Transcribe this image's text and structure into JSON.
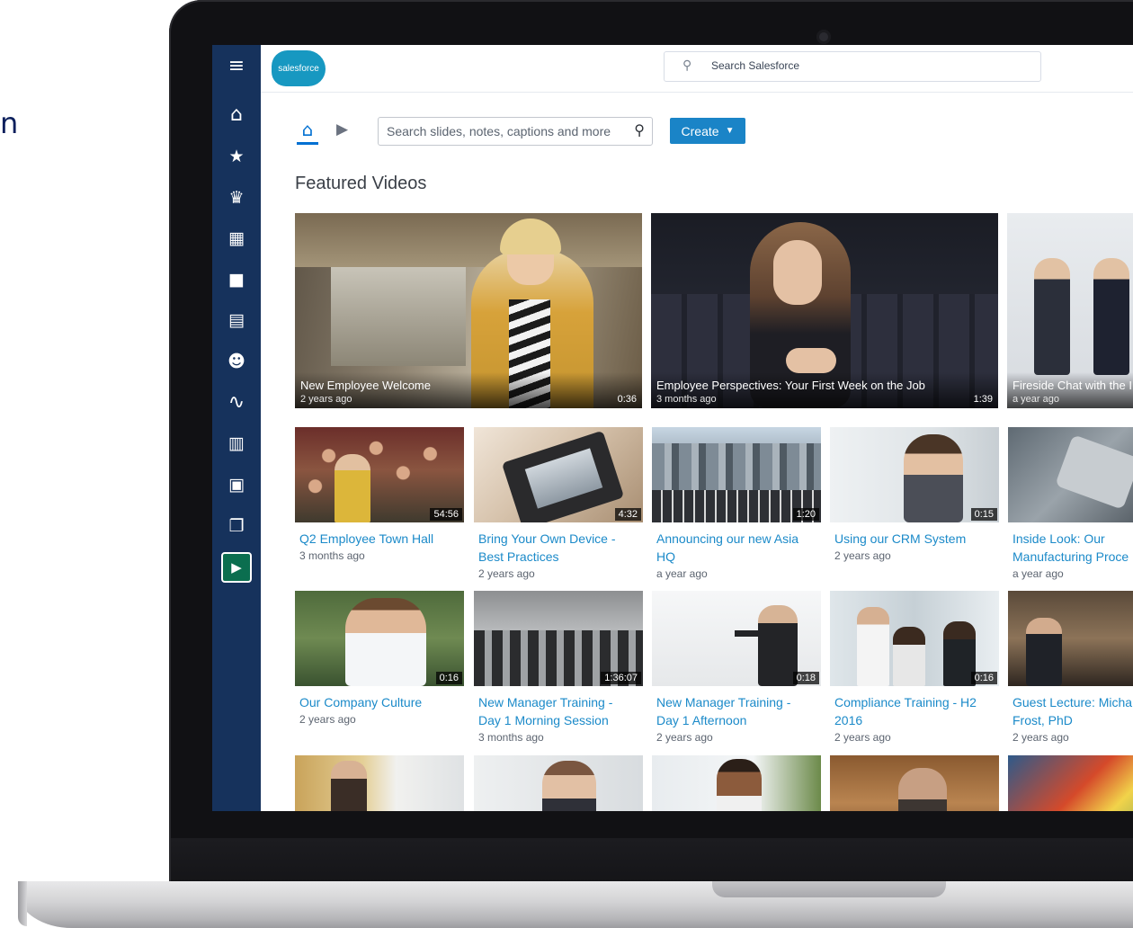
{
  "slide_fragment_text": "n",
  "header": {
    "logo_label": "salesforce",
    "global_search_placeholder": "Search Salesforce"
  },
  "sidebar": {
    "items": [
      {
        "icon": "hamburger-menu-icon",
        "glyph": "≡"
      },
      {
        "icon": "home-icon",
        "glyph": "⌂"
      },
      {
        "icon": "person-star-icon",
        "glyph": "★"
      },
      {
        "icon": "crown-icon",
        "glyph": "♛"
      },
      {
        "icon": "building-icon",
        "glyph": "▦"
      },
      {
        "icon": "briefcase-icon",
        "glyph": "■"
      },
      {
        "icon": "contact-card-icon",
        "glyph": "▤"
      },
      {
        "icon": "groups-icon",
        "glyph": "☻"
      },
      {
        "icon": "activity-pulse-icon",
        "glyph": "∿"
      },
      {
        "icon": "news-feed-icon",
        "glyph": "▥"
      },
      {
        "icon": "report-clipboard-icon",
        "glyph": "▣"
      },
      {
        "icon": "documents-icon",
        "glyph": "❐"
      },
      {
        "icon": "video-app-icon",
        "glyph": "▶",
        "active": true
      }
    ]
  },
  "toolbar": {
    "search_placeholder": "Search slides, notes, captions and more",
    "create_label": "Create",
    "create_caret": "▼"
  },
  "section_title": "Featured Videos",
  "featured": [
    {
      "title": "New Employee Welcome",
      "age": "2 years ago",
      "duration": "0:36"
    },
    {
      "title": "Employee Perspectives: Your First Week on the Job",
      "age": "3 months ago",
      "duration": "1:39"
    },
    {
      "title": "Fireside Chat with the I",
      "age": "a year ago",
      "duration": ""
    }
  ],
  "videos": [
    {
      "title": "Q2 Employee Town Hall",
      "age": "3 months ago",
      "duration": "54:56"
    },
    {
      "title": "Bring Your Own Device - Best Practices",
      "age": "2 years ago",
      "duration": "4:32"
    },
    {
      "title": "Announcing our new Asia HQ",
      "age": "a year ago",
      "duration": "1:20"
    },
    {
      "title": "Using our CRM System",
      "age": "2 years ago",
      "duration": "0:15"
    },
    {
      "title": "Inside Look: Our Manufacturing Proce",
      "age": "a year ago",
      "duration": ""
    },
    {
      "title": "Our Company Culture",
      "age": "2 years ago",
      "duration": "0:16"
    },
    {
      "title": "New Manager Training - Day 1 Morning Session",
      "age": "3 months ago",
      "duration": "1:36:07"
    },
    {
      "title": "New Manager Training - Day 1 Afternoon",
      "age": "2 years ago",
      "duration": "0:18"
    },
    {
      "title": "Compliance Training - H2 2016",
      "age": "2 years ago",
      "duration": "0:16"
    },
    {
      "title": "Guest Lecture: Micha Frost, PhD",
      "age": "2 years ago",
      "duration": ""
    }
  ],
  "colors": {
    "sidebar": "#16325c",
    "link": "#1b8ac9",
    "create_button": "#1a84c7",
    "active_app": "#0b6e4f"
  }
}
